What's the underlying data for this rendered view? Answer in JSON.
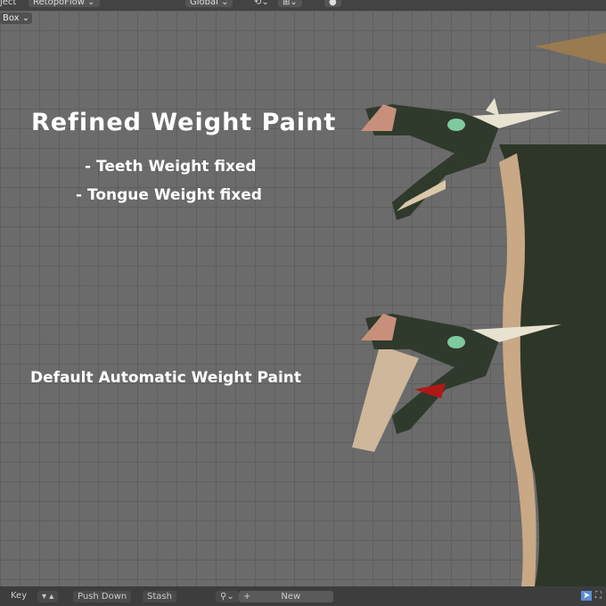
{
  "toolbar": {
    "mode": "ject",
    "addon": "RetopoFlow ⌄",
    "orientation": "Global ⌄",
    "box_select": "Box ⌄"
  },
  "overlay": {
    "title": "Refined Weight Paint",
    "line1": "- Teeth Weight fixed",
    "line2": "- Tongue Weight fixed",
    "label2": "Default Automatic Weight Paint"
  },
  "bottombar": {
    "key": "Key",
    "push_down": "Push Down",
    "stash": "Stash",
    "new": "New",
    "plus": "+"
  }
}
